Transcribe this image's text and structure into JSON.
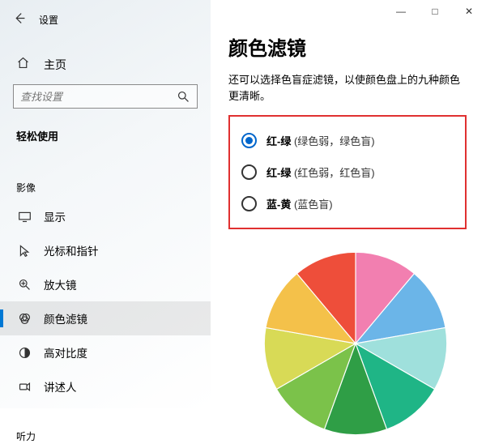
{
  "window": {
    "app_title": "设置",
    "minimize": "—",
    "maximize": "□",
    "close": "✕"
  },
  "sidebar": {
    "home_label": "主页",
    "search_placeholder": "查找设置",
    "section1": "轻松使用",
    "group_vision": "影像",
    "group_hearing": "听力",
    "items": [
      {
        "label": "显示"
      },
      {
        "label": "光标和指针"
      },
      {
        "label": "放大镜"
      },
      {
        "label": "颜色滤镜"
      },
      {
        "label": "高对比度"
      },
      {
        "label": "讲述人"
      }
    ]
  },
  "main": {
    "title": "颜色滤镜",
    "description": "还可以选择色盲症滤镜，以使颜色盘上的九种颜色更清晰。",
    "options": [
      {
        "bold": "红-绿",
        "paren": "(绿色弱，绿色盲)",
        "selected": true
      },
      {
        "bold": "红-绿",
        "paren": "(红色弱，红色盲)",
        "selected": false
      },
      {
        "bold": "蓝-黄",
        "paren": "(蓝色盲)",
        "selected": false
      }
    ]
  },
  "chart_data": {
    "type": "pie",
    "title": "",
    "categories": [
      "slice1",
      "slice2",
      "slice3",
      "slice4",
      "slice5",
      "slice6",
      "slice7",
      "slice8",
      "slice9"
    ],
    "values": [
      1,
      1,
      1,
      1,
      1,
      1,
      1,
      1,
      1
    ],
    "colors": [
      "#f27fb0",
      "#6bb5e8",
      "#9fe0dc",
      "#1fb586",
      "#2f9e46",
      "#7bc24a",
      "#d8da56",
      "#f4c14a",
      "#ee4e3a"
    ]
  }
}
